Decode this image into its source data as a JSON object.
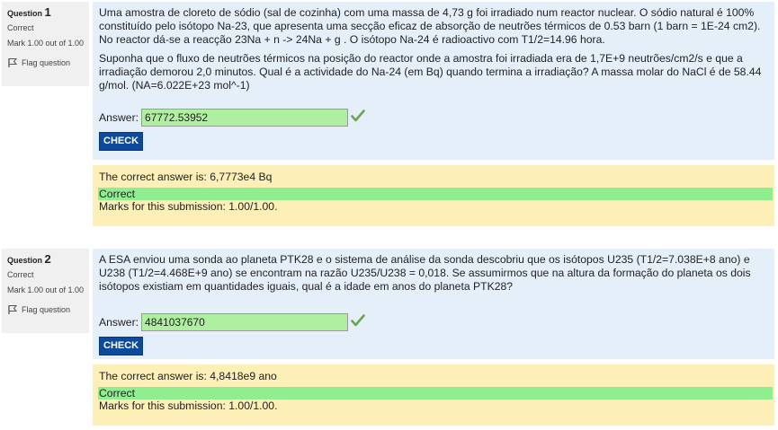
{
  "questions": [
    {
      "label": "Question",
      "number": "1",
      "state": "Correct",
      "grade": "Mark 1.00 out of 1.00",
      "flag_label": "Flag question",
      "paragraphs": [
        "Uma amostra de cloreto de sódio (sal de cozinha) com uma massa de 4,73 g foi irradiado num reactor nuclear. O sódio natural é 100% constituído pelo isótopo Na-23, que apresenta uma secção eficaz de absorção de neutrões térmicos de 0.53 barn (1 barn = 1E-24 cm2). No reactor dá-se a reacção 23Na + n -> 24Na + g . O isótopo Na-24 é radioactivo com T1/2=14.96 hora.",
        "Suponha que o fluxo de neutrões térmicos na posição do reactor onde a amostra foi irradiada era de 1,7E+9 neutrões/cm2/s e que a irradiação demorou 2,0 minutos. Qual é a actividade do Na-24 (em Bq) quando termina a irradiação? A massa molar do NaCl é de 58.44 g/mol. (NA=6.022E+23 mol^-1)"
      ],
      "answer_label": "Answer:",
      "answer_value": "67772.53952",
      "check_label": "CHECK",
      "right_answer": "The correct answer is: 6,7773e4 Bq",
      "feedback": "Correct",
      "marks": "Marks for this submission: 1.00/1.00."
    },
    {
      "label": "Question",
      "number": "2",
      "state": "Correct",
      "grade": "Mark 1.00 out of 1.00",
      "flag_label": "Flag question",
      "paragraphs": [
        "A ESA enviou uma sonda ao planeta PTK28 e o sistema de análise da sonda descobriu que os isótopos U235 (T1/2=7.038E+8 ano) e U238 (T1/2=4.468E+9 ano) se encontram na razão U235/U238 = 0,018. Se assumirmos que na altura da formação do planeta os dois isótopos existiam em quantidades iguais, qual é a idade em anos do planeta PTK28?"
      ],
      "answer_label": "Answer:",
      "answer_value": "4841037670",
      "check_label": "CHECK",
      "right_answer": "The correct answer is: 4,8418e9 ano",
      "feedback": "Correct",
      "marks": "Marks for this submission: 1.00/1.00."
    }
  ]
}
